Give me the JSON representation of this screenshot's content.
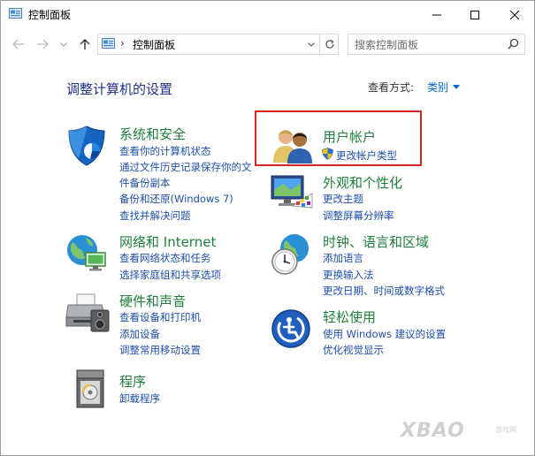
{
  "window": {
    "title": "控制面板"
  },
  "address": {
    "separator": "›",
    "path": "控制面板"
  },
  "search": {
    "placeholder": "搜索控制面板"
  },
  "content": {
    "heading": "调整计算机的设置",
    "view_by_label": "查看方式:",
    "view_by_value": "类别"
  },
  "categories": [
    {
      "title": "系统和安全",
      "icon": "shield-icon",
      "links": [
        "查看你的计算机状态",
        "通过文件历史记录保存你的文",
        "件备份副本",
        "备份和还原(Windows 7)",
        "查找并解决问题"
      ]
    },
    {
      "title": "网络和 Internet",
      "icon": "network-globe-icon",
      "links": [
        "查看网络状态和任务",
        "选择家庭组和共享选项"
      ]
    },
    {
      "title": "硬件和声音",
      "icon": "printer-icon",
      "links": [
        "查看设备和打印机",
        "添加设备",
        "调整常用移动设置"
      ]
    },
    {
      "title": "程序",
      "icon": "programs-icon",
      "links": [
        "卸载程序"
      ]
    },
    {
      "title": "用户帐户",
      "icon": "users-icon",
      "links": [
        "更改帐户类型"
      ]
    },
    {
      "title": "外观和个性化",
      "icon": "monitor-palette-icon",
      "links": [
        "更改主题",
        "调整屏幕分辨率"
      ]
    },
    {
      "title": "时钟、语言和区域",
      "icon": "clock-globe-icon",
      "links": [
        "添加语言",
        "更换输入法",
        "更改日期、时间或数字格式"
      ]
    },
    {
      "title": "轻松使用",
      "icon": "accessibility-icon",
      "links": [
        "使用 Windows 建议的设置",
        "优化视觉显示"
      ]
    }
  ],
  "watermark": {
    "text": "XBAO",
    "sub": "游戏网"
  }
}
